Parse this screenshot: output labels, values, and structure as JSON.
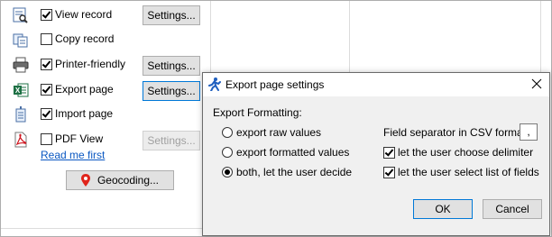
{
  "records": [
    {
      "key": "view",
      "label": "View record",
      "checked": true,
      "icon": "view-record-icon",
      "settings": "Settings...",
      "settings_state": "normal"
    },
    {
      "key": "copy",
      "label": "Copy record",
      "checked": false,
      "icon": "copy-record-icon",
      "settings": null
    },
    {
      "key": "printer",
      "label": "Printer-friendly",
      "checked": true,
      "icon": "printer-icon",
      "settings": "Settings...",
      "settings_state": "normal"
    },
    {
      "key": "export",
      "label": "Export page",
      "checked": true,
      "icon": "excel-export-icon",
      "settings": "Settings...",
      "settings_state": "focused"
    },
    {
      "key": "import",
      "label": "Import page",
      "checked": true,
      "icon": "import-page-icon",
      "settings": null
    },
    {
      "key": "pdf",
      "label": "PDF View",
      "checked": false,
      "icon": "pdf-icon",
      "settings": "Settings...",
      "settings_state": "disabled"
    }
  ],
  "read_me_link": "Read me first",
  "geocoding_button": "Geocoding...",
  "dialog": {
    "title": "Export page settings",
    "section_label": "Export Formatting:",
    "options": [
      {
        "label": "export raw values",
        "selected": false
      },
      {
        "label": "export formatted values",
        "selected": false
      },
      {
        "label": "both, let the user decide",
        "selected": true
      }
    ],
    "separator_label": "Field separator in CSV format:",
    "separator_value": ",",
    "checkboxes": [
      {
        "label": "let the user choose delimiter",
        "checked": true
      },
      {
        "label": "let the user select list of fields",
        "checked": true
      }
    ],
    "ok": "OK",
    "cancel": "Cancel"
  },
  "colors": {
    "link": "#0a58c2",
    "focus_border": "#0078d7",
    "button_bg": "#e1e1e1",
    "dialog_bg": "#f0f0f0"
  }
}
